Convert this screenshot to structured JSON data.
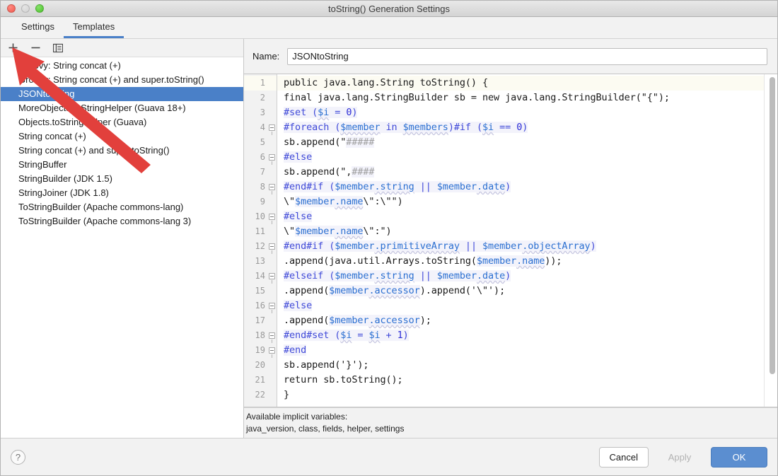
{
  "window": {
    "title": "toString() Generation Settings",
    "traffic_lights": [
      "close-button",
      "minimize-button",
      "maximize-button"
    ]
  },
  "tabs": [
    {
      "label": "Settings",
      "active": false
    },
    {
      "label": "Templates",
      "active": true
    }
  ],
  "list_toolbar": {
    "buttons": [
      {
        "name": "add-template-button",
        "icon": "plus-icon"
      },
      {
        "name": "remove-template-button",
        "icon": "minus-icon"
      },
      {
        "name": "copy-template-button",
        "icon": "copy-icon"
      }
    ]
  },
  "template_list": {
    "selected_index": 2,
    "items": [
      "Groovy: String concat (+)",
      "Groovy: String concat (+) and super.toString()",
      "JSONtoString",
      "MoreObjects.toStringHelper (Guava 18+)",
      "Objects.toStringHelper (Guava)",
      "String concat (+)",
      "String concat (+) and super.toString()",
      "StringBuffer",
      "StringBuilder (JDK 1.5)",
      "StringJoiner (JDK 1.8)",
      "ToStringBuilder (Apache commons-lang)",
      "ToStringBuilder (Apache commons-lang 3)"
    ]
  },
  "name_field": {
    "label": "Name:",
    "value": "JSONtoString",
    "placeholder": ""
  },
  "editor": {
    "current_line": 1,
    "total_lines": 22,
    "lines": [
      {
        "n": 1,
        "fold": false,
        "tokens": [
          {
            "t": "public java.lang.String toString() {",
            "c": "tk-plain"
          }
        ]
      },
      {
        "n": 2,
        "fold": false,
        "tokens": [
          {
            "t": "final java.lang.StringBuilder sb = new java.lang.StringBuilder(\"{\");",
            "c": "tk-plain"
          }
        ]
      },
      {
        "n": 3,
        "fold": false,
        "tokens": [
          {
            "t": "#set ",
            "c": "tk-vtl"
          },
          {
            "t": "(",
            "c": "tk-vtl"
          },
          {
            "t": "$i",
            "c": "tk-var"
          },
          {
            "t": " = ",
            "c": "tk-vtl"
          },
          {
            "t": "0",
            "c": "tk-num"
          },
          {
            "t": ")",
            "c": "tk-vtl"
          }
        ]
      },
      {
        "n": 4,
        "fold": true,
        "tokens": [
          {
            "t": "#foreach ",
            "c": "tk-vtl"
          },
          {
            "t": "(",
            "c": "tk-vtl"
          },
          {
            "t": "$member",
            "c": "tk-var"
          },
          {
            "t": " in ",
            "c": "tk-vtl"
          },
          {
            "t": "$members",
            "c": "tk-var"
          },
          {
            "t": ")",
            "c": "tk-vtl"
          },
          {
            "t": "#if ",
            "c": "tk-vtl"
          },
          {
            "t": "(",
            "c": "tk-vtl"
          },
          {
            "t": "$i",
            "c": "tk-var"
          },
          {
            "t": " == ",
            "c": "tk-vtl"
          },
          {
            "t": "0",
            "c": "tk-num"
          },
          {
            "t": ")",
            "c": "tk-vtl"
          }
        ]
      },
      {
        "n": 5,
        "fold": false,
        "tokens": [
          {
            "t": "sb.append(\"",
            "c": "tk-plain"
          },
          {
            "t": "#####",
            "c": "tk-cmt"
          }
        ]
      },
      {
        "n": 6,
        "fold": true,
        "tokens": [
          {
            "t": "#else",
            "c": "tk-vtl"
          }
        ]
      },
      {
        "n": 7,
        "fold": false,
        "tokens": [
          {
            "t": "sb.append(\",",
            "c": "tk-plain"
          },
          {
            "t": "####",
            "c": "tk-cmt"
          }
        ]
      },
      {
        "n": 8,
        "fold": true,
        "tokens": [
          {
            "t": "#end",
            "c": "tk-vtl"
          },
          {
            "t": "#if ",
            "c": "tk-vtl"
          },
          {
            "t": "(",
            "c": "tk-vtl"
          },
          {
            "t": "$member",
            "c": "tk-var2"
          },
          {
            "t": ".string",
            "c": "tk-var"
          },
          {
            "t": " || ",
            "c": "tk-vtl"
          },
          {
            "t": "$member",
            "c": "tk-var2"
          },
          {
            "t": ".date",
            "c": "tk-var"
          },
          {
            "t": ")",
            "c": "tk-vtl"
          }
        ]
      },
      {
        "n": 9,
        "fold": false,
        "tokens": [
          {
            "t": "\\\"",
            "c": "tk-plain"
          },
          {
            "t": "$member",
            "c": "tk-var2"
          },
          {
            "t": ".name",
            "c": "tk-var"
          },
          {
            "t": "\\\":\\\"\")",
            "c": "tk-plain"
          }
        ]
      },
      {
        "n": 10,
        "fold": true,
        "tokens": [
          {
            "t": "#else",
            "c": "tk-vtl"
          }
        ]
      },
      {
        "n": 11,
        "fold": false,
        "tokens": [
          {
            "t": "\\\"",
            "c": "tk-plain"
          },
          {
            "t": "$member",
            "c": "tk-var2"
          },
          {
            "t": ".name",
            "c": "tk-var"
          },
          {
            "t": "\\\":\")",
            "c": "tk-plain"
          }
        ]
      },
      {
        "n": 12,
        "fold": true,
        "tokens": [
          {
            "t": "#end",
            "c": "tk-vtl"
          },
          {
            "t": "#if ",
            "c": "tk-vtl"
          },
          {
            "t": "(",
            "c": "tk-vtl"
          },
          {
            "t": "$member",
            "c": "tk-var2"
          },
          {
            "t": ".primitiveArray",
            "c": "tk-var"
          },
          {
            "t": " || ",
            "c": "tk-vtl"
          },
          {
            "t": "$member",
            "c": "tk-var2"
          },
          {
            "t": ".objectArray",
            "c": "tk-var"
          },
          {
            "t": ")",
            "c": "tk-vtl"
          }
        ]
      },
      {
        "n": 13,
        "fold": false,
        "tokens": [
          {
            "t": ".append(java.util.Arrays.toString(",
            "c": "tk-plain"
          },
          {
            "t": "$member",
            "c": "tk-var2"
          },
          {
            "t": ".name",
            "c": "tk-var"
          },
          {
            "t": "));",
            "c": "tk-plain"
          }
        ]
      },
      {
        "n": 14,
        "fold": true,
        "tokens": [
          {
            "t": "#elseif ",
            "c": "tk-vtl"
          },
          {
            "t": "(",
            "c": "tk-vtl"
          },
          {
            "t": "$member",
            "c": "tk-var2"
          },
          {
            "t": ".string",
            "c": "tk-var"
          },
          {
            "t": " || ",
            "c": "tk-vtl"
          },
          {
            "t": "$member",
            "c": "tk-var2"
          },
          {
            "t": ".date",
            "c": "tk-var"
          },
          {
            "t": ")",
            "c": "tk-vtl"
          }
        ]
      },
      {
        "n": 15,
        "fold": false,
        "tokens": [
          {
            "t": ".append(",
            "c": "tk-plain"
          },
          {
            "t": "$member",
            "c": "tk-var2"
          },
          {
            "t": ".accessor",
            "c": "tk-var"
          },
          {
            "t": ").append('\\\"');",
            "c": "tk-plain"
          }
        ]
      },
      {
        "n": 16,
        "fold": true,
        "tokens": [
          {
            "t": "#else",
            "c": "tk-vtl"
          }
        ]
      },
      {
        "n": 17,
        "fold": false,
        "tokens": [
          {
            "t": ".append(",
            "c": "tk-plain"
          },
          {
            "t": "$member",
            "c": "tk-var2"
          },
          {
            "t": ".accessor",
            "c": "tk-var"
          },
          {
            "t": ");",
            "c": "tk-plain"
          }
        ]
      },
      {
        "n": 18,
        "fold": true,
        "tokens": [
          {
            "t": "#end",
            "c": "tk-vtl"
          },
          {
            "t": "#set ",
            "c": "tk-vtl"
          },
          {
            "t": "(",
            "c": "tk-vtl"
          },
          {
            "t": "$i",
            "c": "tk-var"
          },
          {
            "t": " = ",
            "c": "tk-vtl"
          },
          {
            "t": "$i",
            "c": "tk-var"
          },
          {
            "t": " + ",
            "c": "tk-vtl"
          },
          {
            "t": "1",
            "c": "tk-num"
          },
          {
            "t": ")",
            "c": "tk-vtl"
          }
        ]
      },
      {
        "n": 19,
        "fold": true,
        "tokens": [
          {
            "t": "#end",
            "c": "tk-vtl"
          }
        ]
      },
      {
        "n": 20,
        "fold": false,
        "tokens": [
          {
            "t": "sb.append('}');",
            "c": "tk-plain"
          }
        ]
      },
      {
        "n": 21,
        "fold": false,
        "tokens": [
          {
            "t": "return sb.toString();",
            "c": "tk-plain"
          }
        ]
      },
      {
        "n": 22,
        "fold": false,
        "tokens": [
          {
            "t": "}",
            "c": "tk-plain"
          }
        ]
      }
    ]
  },
  "hint": {
    "line1": "Available implicit variables:",
    "line2": "java_version, class, fields, helper, settings"
  },
  "footer": {
    "help_label": "?",
    "cancel_label": "Cancel",
    "apply_label": "Apply",
    "ok_label": "OK"
  },
  "annotation": {
    "type": "arrow",
    "color": "#e2403c",
    "points_to": "add-template-button"
  },
  "colors": {
    "accent": "#4a80c8",
    "primary_button": "#5b8ed0",
    "selection": "#4a80c8",
    "annotation_red": "#e2403c",
    "current_line": "#fcfbf2"
  }
}
